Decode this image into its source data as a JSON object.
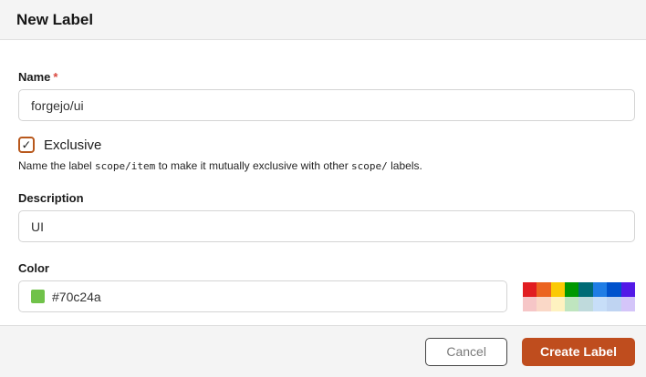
{
  "dialog": {
    "title": "New Label"
  },
  "form": {
    "name": {
      "label": "Name",
      "required_marker": "*",
      "value": "forgejo/ui"
    },
    "exclusive": {
      "label": "Exclusive",
      "checked": true,
      "checkmark": "✓",
      "help": {
        "prefix": "Name the label ",
        "code1": "scope/item",
        "middle": " to make it mutually exclusive with other ",
        "code2": "scope/",
        "suffix": " labels."
      }
    },
    "description": {
      "label": "Description",
      "value": "UI"
    },
    "color": {
      "label": "Color",
      "value": "#70c24a",
      "swatch_color": "#70c24a"
    }
  },
  "palette": {
    "rows": [
      [
        "#e11d21",
        "#eb6420",
        "#fbca04",
        "#009800",
        "#006b75",
        "#207de5",
        "#0052cc",
        "#5319e7"
      ],
      [
        "#f6c6c7",
        "#fad8c7",
        "#fef2c0",
        "#bfe5bf",
        "#bfdadc",
        "#c7def8",
        "#bfd4f2",
        "#d4c5f9"
      ]
    ]
  },
  "footer": {
    "cancel_label": "Cancel",
    "create_label": "Create Label"
  },
  "colors": {
    "accent_button": "#bf4d1e",
    "checkbox_border": "#b8581c",
    "required_asterisk": "#d9473d",
    "header_background": "#f4f4f4",
    "divider": "#e0e0e0",
    "input_border": "#d4d4d4"
  }
}
